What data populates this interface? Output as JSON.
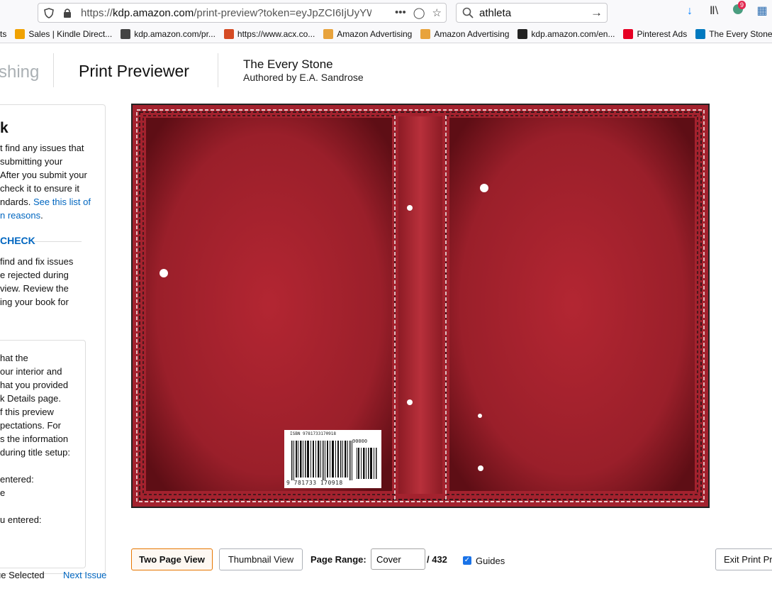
{
  "browser": {
    "url_prefix": "https://",
    "url_host": "kdp.amazon.com",
    "url_rest": "/print-preview?token=eyJpZCI6IjUyYW",
    "url_more": "•••",
    "search_query": "athleta",
    "notification_count": "9"
  },
  "bookmarks": [
    {
      "label": "ts",
      "icon": "text-fragment",
      "color": ""
    },
    {
      "label": "Sales | Kindle Direct...",
      "icon": "bar-chart-icon",
      "color": "#f0a202"
    },
    {
      "label": "kdp.amazon.com/pr...",
      "icon": "globe-icon",
      "color": "#444444"
    },
    {
      "label": "https://www.acx.co...",
      "icon": "acx-icon",
      "color": "#d54b24"
    },
    {
      "label": "Amazon Advertising",
      "icon": "amazon-a-icon",
      "color": "#e8a33c"
    },
    {
      "label": "Amazon Advertising",
      "icon": "amazon-a-icon",
      "color": "#e8a33c"
    },
    {
      "label": "kdp.amazon.com/en...",
      "icon": "amazon-icon",
      "color": "#222222"
    },
    {
      "label": "Pinterest Ads",
      "icon": "pinterest-icon",
      "color": "#e60023"
    },
    {
      "label": "The Every Stone",
      "icon": "trello-icon",
      "color": "#0079bf"
    }
  ],
  "header": {
    "brand_fragment": "shing",
    "app_title": "Print Previewer",
    "book_title": "The Every Stone",
    "book_author": "Authored by E.A. Sandrose"
  },
  "left_panel": {
    "heading_fragment": "k",
    "intro_lines": [
      "t find any issues that",
      " submitting your",
      "After you submit your",
      "check it to ensure it",
      "ndards."
    ],
    "intro_link_1": "See this list of",
    "intro_link_2": "n reasons",
    "intro_link_end": ".",
    "check_label": "CHECK",
    "check_lines": [
      "find and fix issues",
      "e rejected during",
      "view. Review the",
      "ing your book for"
    ],
    "info_lines": [
      "hat the",
      "our interior and",
      "hat you provided",
      "k Details page.",
      "f this preview",
      "pectations. For",
      "s the information",
      "during title setup:",
      "",
      "entered:",
      "e",
      "",
      "u entered:"
    ],
    "issue_status": "ue Selected",
    "next_issue": "Next Issue"
  },
  "cover": {
    "color_base": "#a3222e",
    "color_dark": "#6e1119",
    "isbn_text": "ISBN 9781733170918",
    "price_code": "90000",
    "barcode_number": "9 781733 170918"
  },
  "controls": {
    "two_page_view": "Two Page View",
    "thumbnail_view": "Thumbnail View",
    "page_range_label": "Page Range:",
    "page_range_value": "Cover",
    "page_total": "/ 432",
    "guides_label": "Guides",
    "guides_checked": true,
    "exit_label": "Exit Print Pr"
  }
}
